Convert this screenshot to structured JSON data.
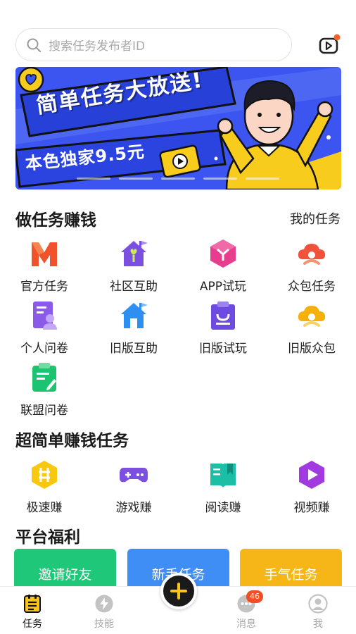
{
  "search": {
    "placeholder": "搜索任务发布者ID"
  },
  "banner": {
    "title": "简单任务大放送!",
    "subtitle": "本色独家9.5元"
  },
  "task_section": {
    "title": "做任务赚钱",
    "link": "我的任务",
    "items": [
      {
        "label": "官方任务",
        "icon": "official-m-icon",
        "color": "#f0532c"
      },
      {
        "label": "社区互助",
        "icon": "community-house-icon",
        "color": "#7b4fe0"
      },
      {
        "label": "APP试玩",
        "icon": "app-trial-hexagon-icon",
        "color": "#e83c8c"
      },
      {
        "label": "众包任务",
        "icon": "crowdsource-cloud-icon",
        "color": "#f0533a"
      },
      {
        "label": "个人问卷",
        "icon": "personal-survey-icon",
        "color": "#8a5ae8"
      },
      {
        "label": "旧版互助",
        "icon": "old-community-house-icon",
        "color": "#2f8ff0"
      },
      {
        "label": "旧版试玩",
        "icon": "old-trial-bag-icon",
        "color": "#6d4be0"
      },
      {
        "label": "旧版众包",
        "icon": "old-crowdsource-cloud-icon",
        "color": "#f5b10a"
      },
      {
        "label": "联盟问卷",
        "icon": "alliance-survey-clipboard-icon",
        "color": "#1cc472"
      }
    ]
  },
  "simple_section": {
    "title": "超简单赚钱任务",
    "items": [
      {
        "label": "极速赚",
        "icon": "speed-earn-hexagon-icon",
        "color": "#f8c80e"
      },
      {
        "label": "游戏赚",
        "icon": "gamepad-icon",
        "color": "#7b4fe0"
      },
      {
        "label": "阅读赚",
        "icon": "book-icon",
        "color": "#1cbfa6"
      },
      {
        "label": "视频赚",
        "icon": "video-play-icon",
        "color": "#a13be0"
      }
    ]
  },
  "welfare_section": {
    "title": "平台福利",
    "cards": [
      {
        "label": "邀请好友",
        "color": "#1fc878"
      },
      {
        "label": "新手任务",
        "color": "#3f8ef5"
      },
      {
        "label": "手气任务",
        "color": "#f7b618"
      }
    ]
  },
  "tabbar": {
    "items": [
      {
        "label": "任务",
        "icon": "task-list-icon",
        "active": true
      },
      {
        "label": "技能",
        "icon": "lightning-icon",
        "active": false
      },
      {
        "label": "消息",
        "icon": "message-icon",
        "active": false,
        "badge": "46"
      },
      {
        "label": "我",
        "icon": "profile-icon",
        "active": false
      }
    ]
  },
  "colors": {
    "accent": "#f7c51b",
    "banner_blue": "#3c55f0"
  }
}
